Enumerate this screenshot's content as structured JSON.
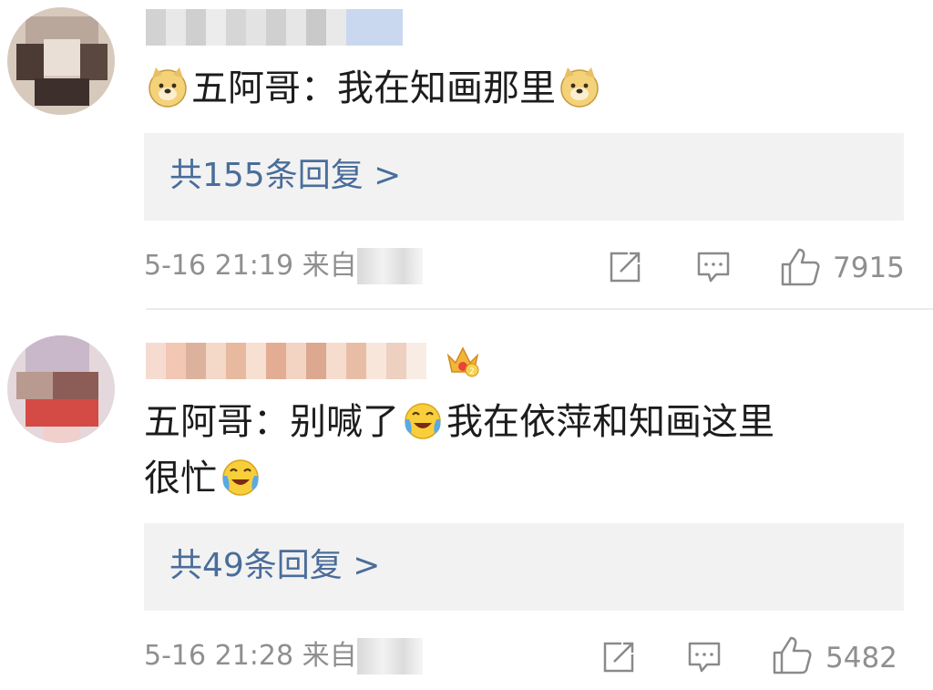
{
  "comments": [
    {
      "author_prefix": "五阿哥：",
      "text_body": "我在知画那里",
      "replies_label": "共155条回复 >",
      "meta": {
        "time": "5-16 21:19",
        "source_prefix": "来自"
      },
      "like_count": "7915",
      "emoji": "doge-emoji"
    },
    {
      "author_prefix": "五阿哥：",
      "text_part1": "别喊了",
      "text_part2": "我在依萍和知画这里",
      "text_line2": "很忙",
      "replies_label": "共49条回复 >",
      "meta": {
        "time": "5-16 21:28",
        "source_prefix": "来自"
      },
      "like_count": "5482",
      "emoji": "laugh-cry-emoji",
      "badge": "crown-badge-icon"
    }
  ],
  "colors": {
    "reply_link": "#4a6d9a",
    "meta_gray": "#8f8f8f",
    "reply_bg": "#f2f2f2",
    "divider": "#ececec"
  },
  "icons": [
    "share-icon",
    "comment-icon",
    "like-icon"
  ]
}
